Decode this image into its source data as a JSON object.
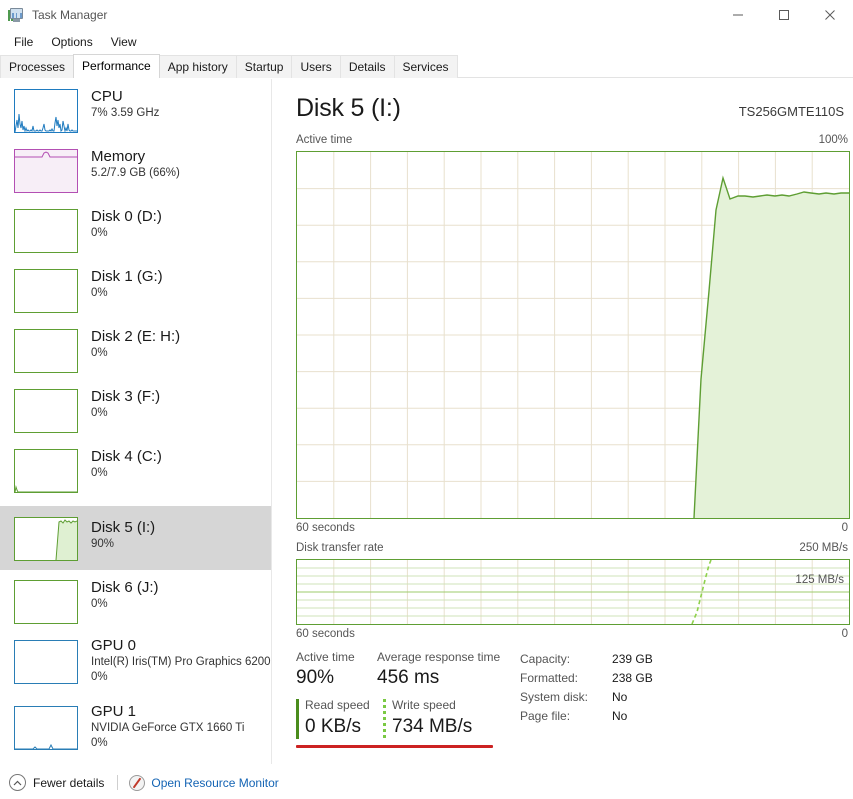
{
  "window": {
    "title": "Task Manager",
    "icon": "task-manager-icon",
    "minimize": "—",
    "maximize": "□",
    "close": "✕"
  },
  "menu": [
    "File",
    "Options",
    "View"
  ],
  "tabs": [
    {
      "label": "Processes",
      "active": false
    },
    {
      "label": "Performance",
      "active": true
    },
    {
      "label": "App history",
      "active": false
    },
    {
      "label": "Startup",
      "active": false
    },
    {
      "label": "Users",
      "active": false
    },
    {
      "label": "Details",
      "active": false
    },
    {
      "label": "Services",
      "active": false
    }
  ],
  "sidebar": {
    "items": [
      {
        "name": "CPU",
        "sub": "7%  3.59 GHz",
        "sub2": "",
        "kind": "cpu",
        "selected": false,
        "accent": "#1f7bbf"
      },
      {
        "name": "Memory",
        "sub": "5.2/7.9 GB (66%)",
        "sub2": "",
        "kind": "mem",
        "selected": false,
        "accent": "#b34fb3"
      },
      {
        "name": "Disk 0 (D:)",
        "sub": "0%",
        "sub2": "",
        "kind": "disk",
        "selected": false,
        "accent": "#5e9e33"
      },
      {
        "name": "Disk 1 (G:)",
        "sub": "0%",
        "sub2": "",
        "kind": "disk",
        "selected": false,
        "accent": "#5e9e33"
      },
      {
        "name": "Disk 2 (E: H:)",
        "sub": "0%",
        "sub2": "",
        "kind": "disk",
        "selected": false,
        "accent": "#5e9e33"
      },
      {
        "name": "Disk 3 (F:)",
        "sub": "0%",
        "sub2": "",
        "kind": "disk",
        "selected": false,
        "accent": "#5e9e33"
      },
      {
        "name": "Disk 4 (C:)",
        "sub": "0%",
        "sub2": "",
        "kind": "disk",
        "selected": false,
        "accent": "#5e9e33"
      },
      {
        "name": "Disk 5 (I:)",
        "sub": "90%",
        "sub2": "",
        "kind": "disk",
        "selected": true,
        "accent": "#5e9e33"
      },
      {
        "name": "Disk 6 (J:)",
        "sub": "0%",
        "sub2": "",
        "kind": "disk",
        "selected": false,
        "accent": "#5e9e33"
      },
      {
        "name": "GPU 0",
        "sub": "Intel(R) Iris(TM) Pro Graphics 6200",
        "sub2": "0%",
        "kind": "gpu",
        "selected": false,
        "accent": "#2a7db5"
      },
      {
        "name": "GPU 1",
        "sub": "NVIDIA GeForce GTX 1660 Ti",
        "sub2": "0%",
        "kind": "gpu",
        "selected": false,
        "accent": "#2a7db5"
      }
    ]
  },
  "main": {
    "title": "Disk 5 (I:)",
    "model": "TS256GMTE110S",
    "active_graph": {
      "caption": "Active time",
      "max_label": "100%",
      "x_left_label": "60 seconds",
      "x_right_label": "0"
    },
    "rate_graph": {
      "caption": "Disk transfer rate",
      "max_label": "250 MB/s",
      "mid_label": "125 MB/s",
      "x_left_label": "60 seconds",
      "x_right_label": "0"
    },
    "stats": {
      "active_time_label": "Active time",
      "active_time_value": "90%",
      "response_label": "Average response time",
      "response_value": "456 ms",
      "read_label": "Read speed",
      "read_value": "0 KB/s",
      "write_label": "Write speed",
      "write_value": "734 MB/s"
    },
    "info": [
      {
        "key": "Capacity:",
        "value": "239 GB"
      },
      {
        "key": "Formatted:",
        "value": "238 GB"
      },
      {
        "key": "System disk:",
        "value": "No"
      },
      {
        "key": "Page file:",
        "value": "No"
      }
    ],
    "highlight_color": "#cc2222"
  },
  "footer": {
    "fewer_details": "Fewer details",
    "chevron": "⌃",
    "resource_monitor": "Open Resource Monitor"
  },
  "chart_data": [
    {
      "type": "area",
      "title": "Active time",
      "ylabel": "Active time (%)",
      "xlabel": "60 seconds",
      "ylim": [
        0,
        100
      ],
      "xlim": [
        0,
        60
      ],
      "grid": true,
      "x": [
        0,
        2,
        4,
        6,
        8,
        10,
        12,
        14,
        16,
        18,
        20,
        22,
        24,
        26,
        28,
        30,
        32,
        34,
        36,
        38,
        40,
        42,
        44,
        44.8,
        45.6,
        46.4,
        47.2,
        48,
        48.8,
        49.6,
        50.4,
        51.2,
        52,
        52.8,
        53.6,
        54.4,
        55.2,
        56,
        56.8,
        57.6,
        58.4,
        59.2,
        60
      ],
      "values": [
        0,
        0,
        0,
        0,
        0,
        0,
        0,
        0,
        0,
        0,
        0,
        0,
        0,
        0,
        0,
        0,
        0,
        0,
        0,
        0,
        0,
        0,
        0,
        18,
        62,
        88,
        96,
        89,
        88,
        88,
        89,
        89,
        88,
        89,
        90,
        89,
        90,
        91,
        90,
        89,
        90,
        91,
        90
      ]
    },
    {
      "type": "line",
      "title": "Disk transfer rate",
      "ylabel": "MB/s",
      "xlabel": "60 seconds",
      "ylim": [
        0,
        250
      ],
      "xlim": [
        0,
        60
      ],
      "grid": true,
      "x": [
        0,
        10,
        20,
        30,
        40,
        44,
        45,
        46,
        47,
        48,
        49,
        50,
        51,
        52,
        53,
        54,
        55,
        56,
        57,
        58,
        59,
        60
      ],
      "values": [
        0,
        0,
        0,
        0,
        0,
        0,
        12,
        40,
        95,
        165,
        230,
        250,
        250,
        250,
        250,
        250,
        250,
        250,
        250,
        250,
        250,
        250
      ]
    }
  ]
}
